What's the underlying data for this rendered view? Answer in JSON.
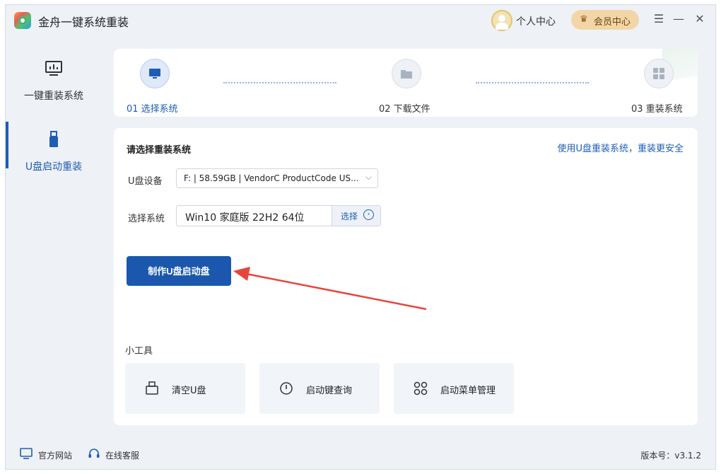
{
  "app": {
    "title": "金舟一键系统重装"
  },
  "header": {
    "personal_center": "个人中心",
    "vip_center": "会员中心"
  },
  "sidebar": {
    "items": [
      {
        "label": "一键重装系统",
        "icon": "monitor-chart-icon"
      },
      {
        "label": "U盘启动重装",
        "icon": "usb-drive-icon"
      }
    ]
  },
  "steps": [
    {
      "label": "01 选择系统",
      "icon": "monitor-icon",
      "active": true
    },
    {
      "label": "02 下载文件",
      "icon": "folder-icon",
      "active": false
    },
    {
      "label": "03 重装系统",
      "icon": "grid-icon",
      "active": false
    }
  ],
  "main": {
    "section_title": "请选择重装系统",
    "hint_link": "使用U盘重装系统，重装更安全",
    "usb_label": "U盘设备",
    "usb_value": "F: | 58.59GB | VendorC ProductCode US...",
    "system_label": "选择系统",
    "system_value": "Win10 家庭版 22H2 64位",
    "choose_label": "选择",
    "make_button": "制作U盘启动盘",
    "tools_title": "小工具",
    "tools": [
      {
        "label": "清空U盘",
        "icon": "usb-clear-icon"
      },
      {
        "label": "启动键查询",
        "icon": "power-icon"
      },
      {
        "label": "启动菜单管理",
        "icon": "menu-grid-icon"
      }
    ]
  },
  "footer": {
    "website": "官方网站",
    "support": "在线客服",
    "version": "版本号：v3.1.2"
  },
  "colors": {
    "accent": "#1b58ad",
    "arrow": "#e8463c",
    "background": "#eef1f6"
  }
}
